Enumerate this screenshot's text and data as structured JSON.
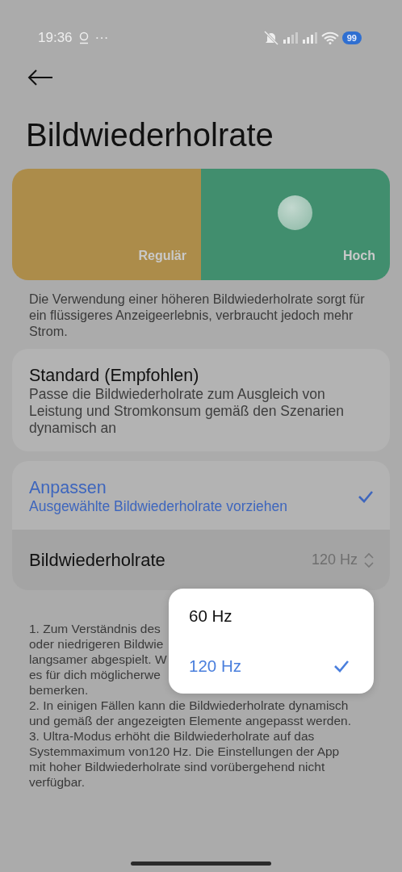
{
  "status_bar": {
    "time": "19:36",
    "more": "···",
    "battery": "99"
  },
  "title": "Bildwiederholrate",
  "modes": [
    {
      "label": "Regulär",
      "selected": false
    },
    {
      "label": "Hoch",
      "selected": true
    }
  ],
  "description": "Die Verwendung einer höheren Bildwiederholrate sorgt für ein flüssigeres Anzeigeerlebnis, verbraucht jedoch mehr Strom.",
  "options": [
    {
      "title": "Standard (Empfohlen)",
      "subtitle": "Passe die Bildwiederholrate zum Ausgleich von Leistung und Stromkonsum gemäß den Szenarien dynamisch an",
      "selected": false
    },
    {
      "title": "Anpassen",
      "subtitle": "Ausgewählte Bildwiederholrate vorziehen",
      "selected": true
    }
  ],
  "rate_row": {
    "label": "Bildwiederholrate",
    "value": "120 Hz"
  },
  "notes": [
    "1. Zum Verständnis des",
    "oder niedrigeren Bildwie",
    "langsamer abgespielt. W",
    "es für dich möglicherwe",
    "bemerken.",
    "2. In einigen Fällen kann die Bildwiederholrate dynamisch",
    "und gemäß der angezeigten Elemente angepasst werden.",
    "3. Ultra-Modus erhöht die Bildwiederholrate auf das",
    "Systemmaximum von120 Hz. Die Einstellungen der App",
    "mit hoher Bildwiederholrate sind vorübergehend nicht",
    "verfügbar."
  ],
  "menu": [
    {
      "label": "60 Hz",
      "selected": false
    },
    {
      "label": "120 Hz",
      "selected": true
    }
  ]
}
